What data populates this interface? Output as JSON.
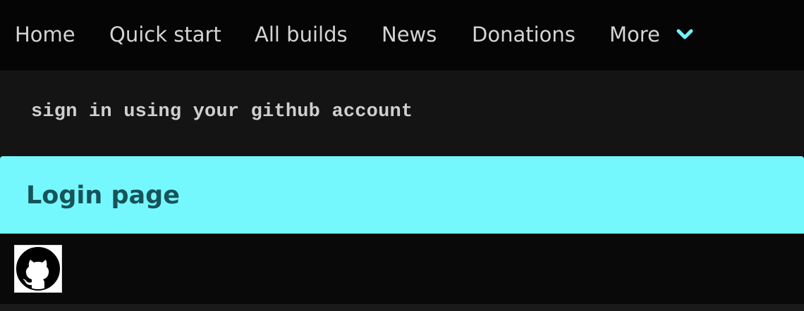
{
  "nav": {
    "items": [
      {
        "label": "Home"
      },
      {
        "label": "Quick start"
      },
      {
        "label": "All builds"
      },
      {
        "label": "News"
      },
      {
        "label": "Donations"
      },
      {
        "label": "More",
        "icon": "chevron-down-icon"
      }
    ]
  },
  "banner": {
    "text": "sign in using your github account"
  },
  "login": {
    "title": "Login page",
    "github_button_icon": "github-icon"
  },
  "colors": {
    "nav_background": "#050505",
    "banner_background": "#141414",
    "header_accent": "#75f8fd",
    "header_text": "#17535a",
    "chevron": "#6ef3f8"
  }
}
